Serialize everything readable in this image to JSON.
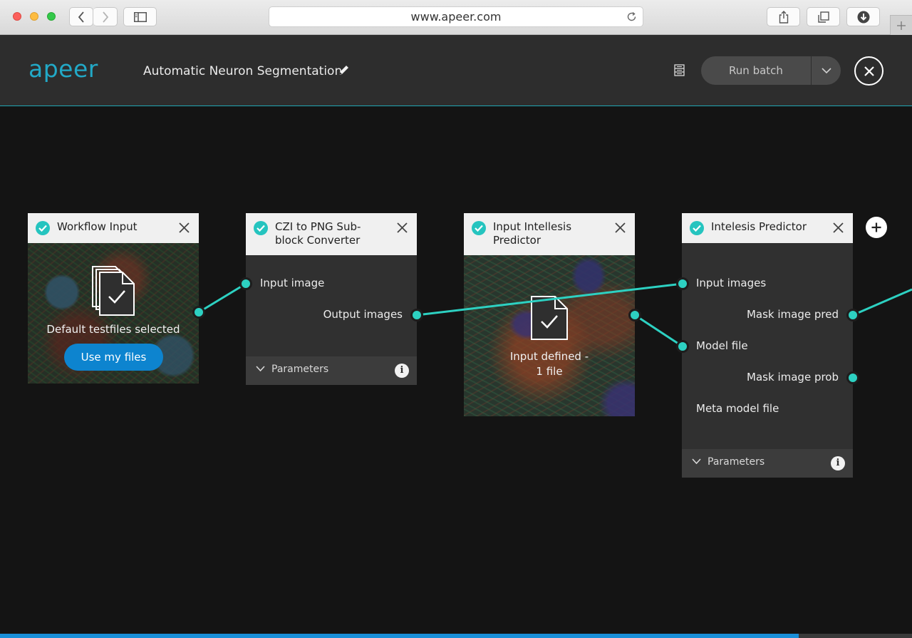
{
  "browser": {
    "url": "www.apeer.com"
  },
  "header": {
    "logo": "apeer",
    "workflow_title": "Automatic Neuron Segmentation",
    "run_batch_label": "Run batch"
  },
  "nodes": [
    {
      "title": "Workflow Input",
      "status_text": "Default testfiles selected",
      "button_label": "Use my files"
    },
    {
      "title": "CZI to PNG Sub-block Converter",
      "inputs": [
        "Input image"
      ],
      "outputs": [
        "Output images"
      ],
      "params_label": "Parameters"
    },
    {
      "title": "Input Intellesis Predictor",
      "status_line1": "Input defined -",
      "status_line2": "1 file"
    },
    {
      "title": "Intelesis Predictor",
      "inputs": [
        "Input images",
        "Model file",
        "Meta model file"
      ],
      "outputs": [
        "Mask image pred",
        "Mask image prob"
      ],
      "params_label": "Parameters"
    }
  ],
  "progress": {
    "fraction": 0.876
  },
  "colors": {
    "accent": "#2dd1c2",
    "brand": "#22a9c7",
    "button_blue": "#0d84cf"
  }
}
